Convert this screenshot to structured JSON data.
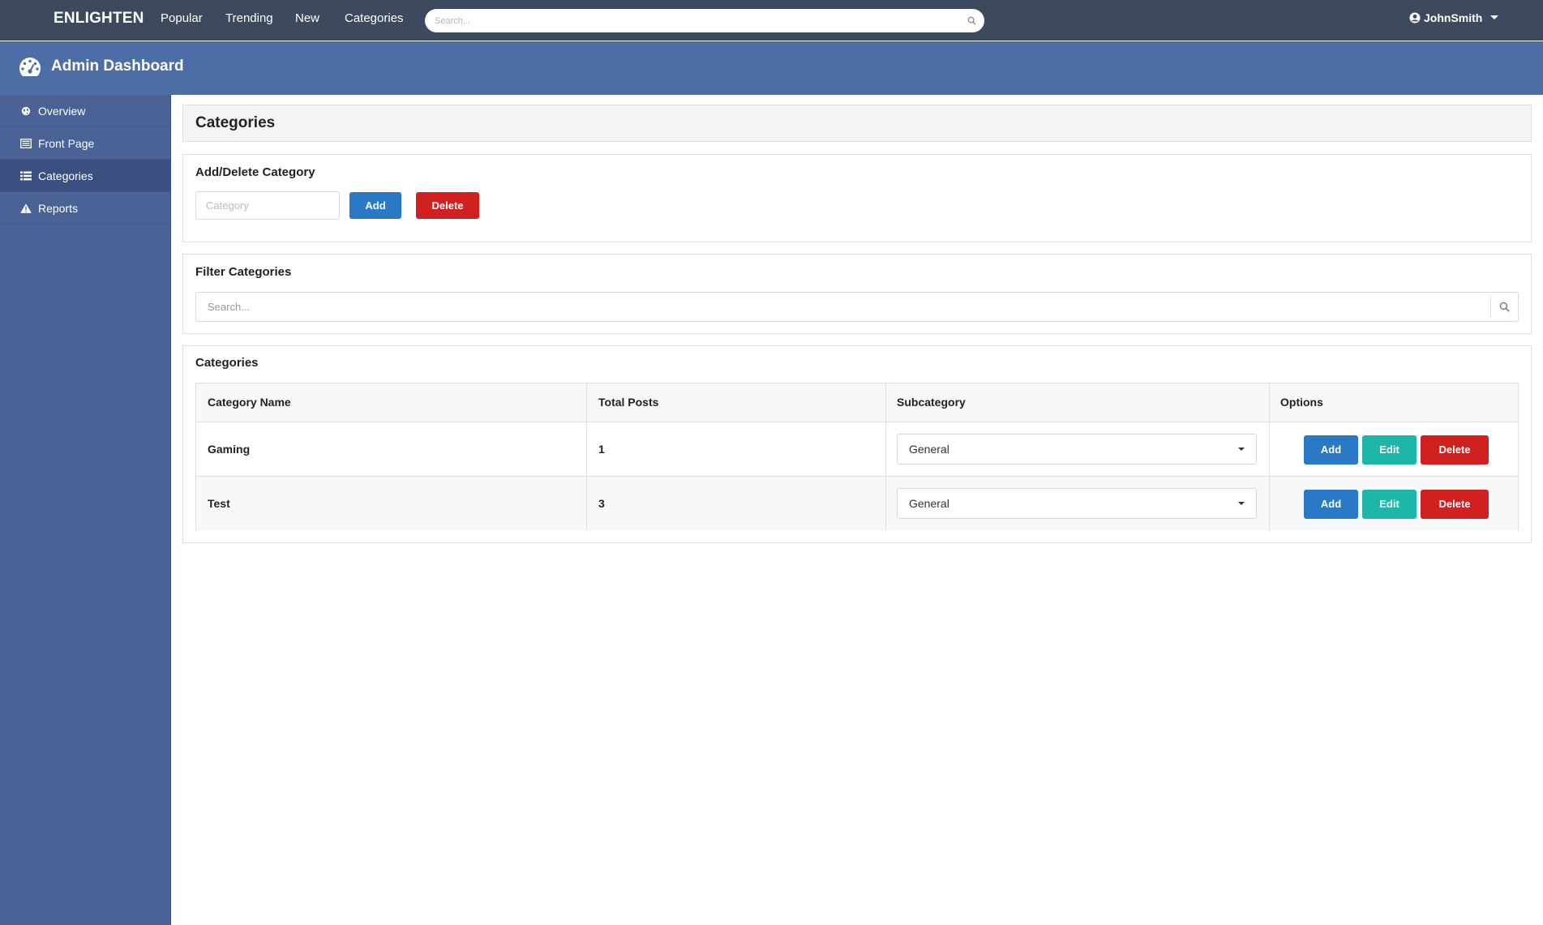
{
  "navbar": {
    "brand": "ENLIGHTEN",
    "links": [
      "Popular",
      "Trending",
      "New",
      "Categories"
    ],
    "search_placeholder": "Search...",
    "username": "JohnSmith"
  },
  "header": {
    "title": "Admin Dashboard"
  },
  "sidebar": {
    "items": [
      {
        "label": "Overview",
        "icon": "globe-icon"
      },
      {
        "label": "Front Page",
        "icon": "newspaper-icon"
      },
      {
        "label": "Categories",
        "icon": "list-icon",
        "active": true
      },
      {
        "label": "Reports",
        "icon": "warning-icon"
      }
    ]
  },
  "main": {
    "page_title": "Categories",
    "add_delete": {
      "title": "Add/Delete Category",
      "input_placeholder": "Category",
      "add_label": "Add",
      "delete_label": "Delete"
    },
    "filter": {
      "title": "Filter Categories",
      "search_placeholder": "Search..."
    },
    "table": {
      "title": "Categories",
      "headers": [
        "Category Name",
        "Total Posts",
        "Subcategory",
        "Options"
      ],
      "rows": [
        {
          "name": "Gaming",
          "total_posts": "1",
          "subcategory": "General"
        },
        {
          "name": "Test",
          "total_posts": "3",
          "subcategory": "General"
        }
      ],
      "option_labels": {
        "add": "Add",
        "edit": "Edit",
        "delete": "Delete"
      }
    }
  },
  "colors": {
    "navbar": "#3d4a5d",
    "header": "#4d6da7",
    "sidebar": "#4a6296",
    "primary": "#2979c7",
    "danger": "#d0201f",
    "teal": "#1eb6a9"
  }
}
